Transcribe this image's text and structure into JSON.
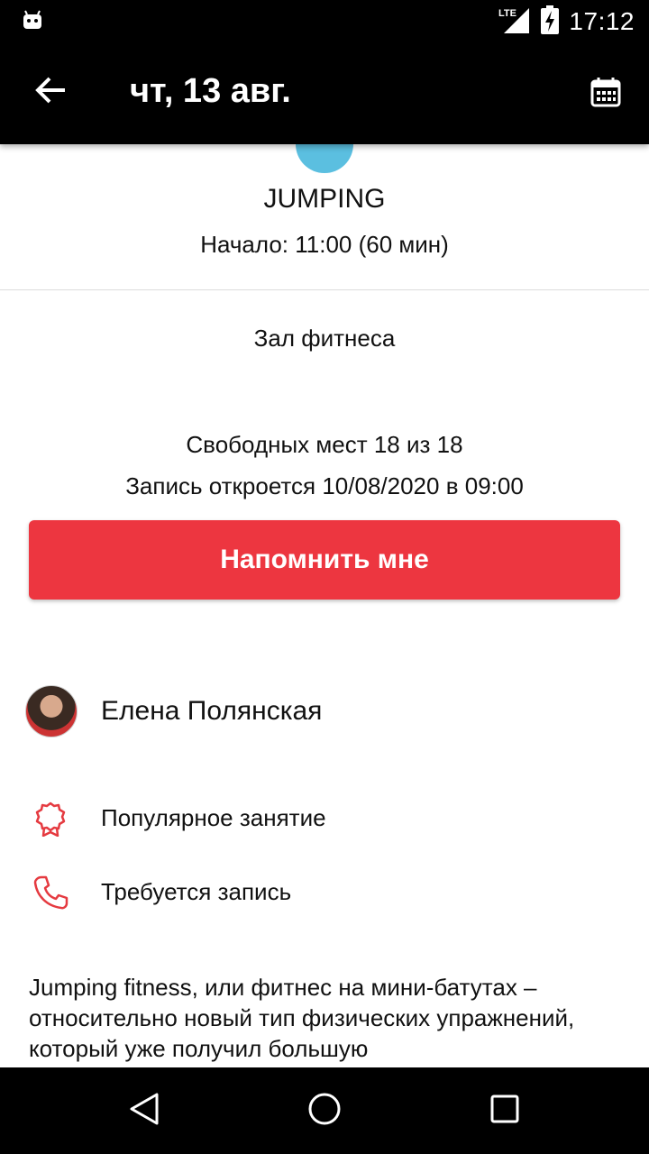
{
  "status_bar": {
    "time": "17:12",
    "network": "LTE",
    "icons": [
      "android-icon",
      "lte-signal-icon",
      "battery-charging-icon"
    ]
  },
  "app_bar": {
    "title": "чт, 13 авг.",
    "back_icon": "arrow-left-icon",
    "calendar_icon": "calendar-icon"
  },
  "class": {
    "color": "#5bbfe0",
    "name": "JUMPING",
    "start": "Начало: 11:00 (60 мин)",
    "room": "Зал фитнеса",
    "free_places": "Свободных мест 18 из 18",
    "booking_opens": "Запись откроется 10/08/2020 в 09:00"
  },
  "remind_button": {
    "label": "Напомнить мне",
    "color": "#ed3640"
  },
  "trainer": {
    "name": "Елена Полянская"
  },
  "features": [
    {
      "icon": "award-ribbon-icon",
      "label": "Популярное занятие"
    },
    {
      "icon": "phone-icon",
      "label": "Требуется запись"
    }
  ],
  "description": "Jumping fitness, или фитнес на мини-батутах – относительно новый тип физических упражнений, который уже получил большую",
  "nav_bar": {
    "icons": [
      "back-triangle-icon",
      "home-circle-icon",
      "recents-square-icon"
    ]
  }
}
